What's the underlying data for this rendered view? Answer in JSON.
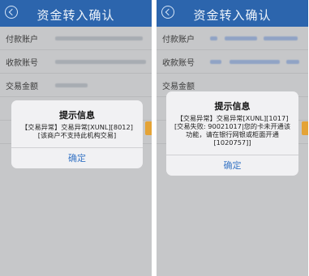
{
  "screens": [
    {
      "header": {
        "title": "资金转入确认"
      },
      "form": {
        "payer_label": "付款账户",
        "payee_label": "收款账号",
        "amount_label": "交易金额"
      },
      "dialog": {
        "title": "提示信息",
        "message": "【交易异常】交易异常[XUNL][8012][该商户不支持此机构交易]",
        "button": "确定"
      }
    },
    {
      "header": {
        "title": "资金转入确认"
      },
      "form": {
        "payer_label": "付款账户",
        "payee_label": "收款账号",
        "amount_label": "交易金额"
      },
      "dialog": {
        "title": "提示信息",
        "message": "【交易异常】交易异常[XUNL][1017][交易失败: 90021017|您的卡未开通该功能，请在银行网银或柜面开通[1020757]]",
        "button": "确定"
      }
    }
  ],
  "colors": {
    "header": "#2c65ad",
    "overlay": "#c6c7c9",
    "dialog_button": "#3a77c6",
    "accent_orange": "#e4a336"
  },
  "icons": [
    "back-arrow-icon"
  ]
}
